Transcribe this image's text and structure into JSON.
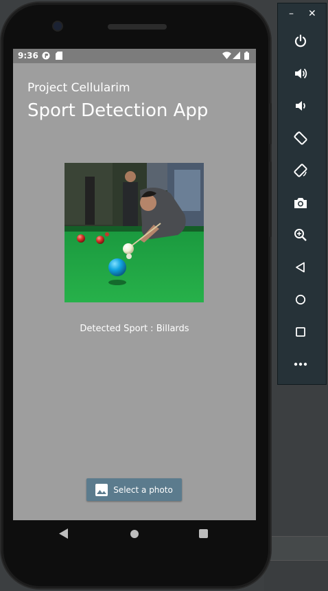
{
  "emulator_panel": {
    "minimize_label": "–",
    "close_label": "✕",
    "controls": [
      {
        "name": "power-icon"
      },
      {
        "name": "volume-up-icon"
      },
      {
        "name": "volume-down-icon"
      },
      {
        "name": "rotate-left-icon"
      },
      {
        "name": "rotate-right-icon"
      },
      {
        "name": "camera-icon"
      },
      {
        "name": "zoom-icon"
      },
      {
        "name": "back-icon"
      },
      {
        "name": "home-icon"
      },
      {
        "name": "overview-icon"
      },
      {
        "name": "more-icon"
      }
    ]
  },
  "status_bar": {
    "time": "9:36",
    "icons": [
      "app-notification-icon",
      "sd-card-icon",
      "wifi-icon",
      "signal-icon",
      "battery-icon"
    ]
  },
  "app": {
    "subtitle": "Project Cellularim",
    "title": "Sport Detection App",
    "image_description": "billiards",
    "result_text": "Detected Sport : Billards",
    "select_button_label": "Select a photo"
  },
  "colors": {
    "screen_background": "#9e9e9e",
    "button_background": "#5b7b8d",
    "panel_background": "#263238",
    "table_felt": "#1f8a3a"
  }
}
